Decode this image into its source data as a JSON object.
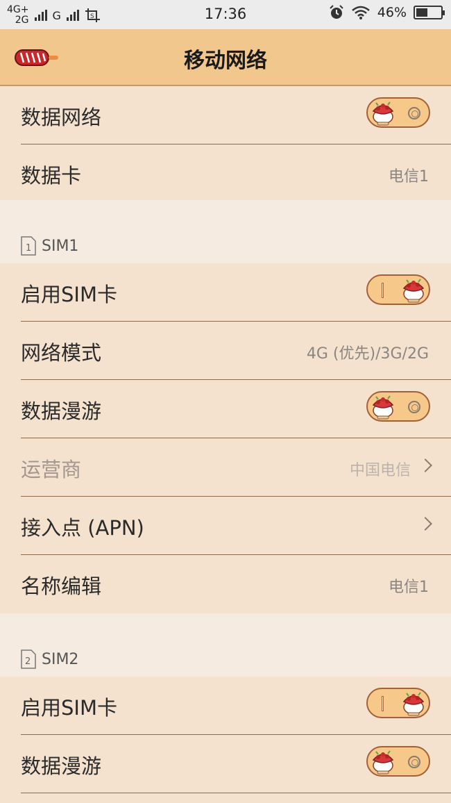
{
  "status_bar": {
    "network_top": "4G+",
    "network_bottom": "2G",
    "network2": "G",
    "time": "17:36",
    "battery": "46%",
    "battery_level": 0.46,
    "icons": [
      "signal-icon",
      "screenshot-icon",
      "alarm-icon",
      "wifi-icon",
      "battery-icon"
    ]
  },
  "header": {
    "title": "移动网络",
    "back_icon": "candy-back-icon"
  },
  "general": [
    {
      "label": "数据网络",
      "toggle": "off"
    },
    {
      "label": "数据卡",
      "value": "电信1"
    }
  ],
  "sim1": {
    "header": "SIM1",
    "badge": "1",
    "rows": [
      {
        "label": "启用SIM卡",
        "toggle": "on"
      },
      {
        "label": "网络模式",
        "value": "4G (优先)/3G/2G"
      },
      {
        "label": "数据漫游",
        "toggle": "off"
      },
      {
        "label": "运营商",
        "value": "中国电信",
        "chevron": true,
        "disabled": true
      },
      {
        "label": "接入点 (APN)",
        "chevron": true
      },
      {
        "label": "名称编辑",
        "value": "电信1"
      }
    ]
  },
  "sim2": {
    "header": "SIM2",
    "badge": "2",
    "rows": [
      {
        "label": "启用SIM卡",
        "toggle": "on"
      },
      {
        "label": "数据漫游",
        "toggle": "off"
      }
    ]
  },
  "colors": {
    "title_bar": "#f2c78e",
    "row_bg": "#f4e2cf",
    "page_bg": "#f5ebe0",
    "toggle_track": "#f6c88a",
    "divider": "#8a6a4a"
  }
}
